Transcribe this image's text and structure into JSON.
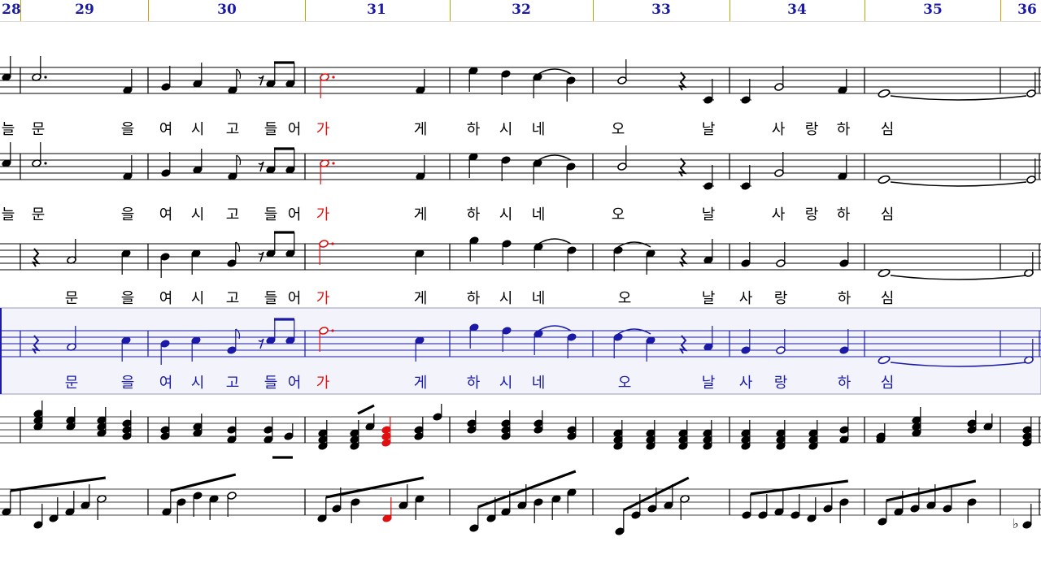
{
  "measure_numbers": [
    "28",
    "29",
    "30",
    "31",
    "32",
    "33",
    "34",
    "35",
    "36"
  ],
  "colors": {
    "measure_number": "#1a1aa6",
    "ruler_tick": "#c8a000",
    "normal_note": "#000000",
    "current_note": "#e01010",
    "selected_staff": "#1a1aa6",
    "selected_band": "#f2f3fb"
  },
  "vocal_staves": [
    {
      "name": "voice-1",
      "selected": false,
      "lyrics": [
        "늘",
        "문",
        "을",
        "여",
        "시",
        "고",
        "들",
        "어",
        "가",
        "게",
        "하",
        "시",
        "네",
        "오",
        "날",
        "사",
        "랑",
        "하",
        "심"
      ],
      "current_lyric_index": 8
    },
    {
      "name": "voice-2",
      "selected": false,
      "lyrics": [
        "늘",
        "문",
        "을",
        "여",
        "시",
        "고",
        "들",
        "어",
        "가",
        "게",
        "하",
        "시",
        "네",
        "오",
        "날",
        "사",
        "랑",
        "하",
        "심"
      ],
      "current_lyric_index": 8
    },
    {
      "name": "voice-3",
      "selected": false,
      "lyrics": [
        "문",
        "을",
        "여",
        "시",
        "고",
        "들",
        "어",
        "가",
        "게",
        "하",
        "시",
        "네",
        "오",
        "날",
        "사",
        "랑",
        "하",
        "심"
      ],
      "current_lyric_index": 7
    },
    {
      "name": "voice-4",
      "selected": true,
      "lyrics": [
        "문",
        "을",
        "여",
        "시",
        "고",
        "들",
        "어",
        "가",
        "게",
        "하",
        "시",
        "네",
        "오",
        "날",
        "사",
        "랑",
        "하",
        "심"
      ],
      "current_lyric_index": 7
    }
  ],
  "piano_staves": [
    {
      "name": "piano-right-hand"
    },
    {
      "name": "piano-left-hand"
    }
  ],
  "icons": {
    "treble_notehead": "filled-ellipse",
    "half_note": "hollow-ellipse",
    "whole_note": "hollow-wide-ellipse",
    "rest": "quarter-rest-glyph",
    "flat": "flat-glyph"
  }
}
